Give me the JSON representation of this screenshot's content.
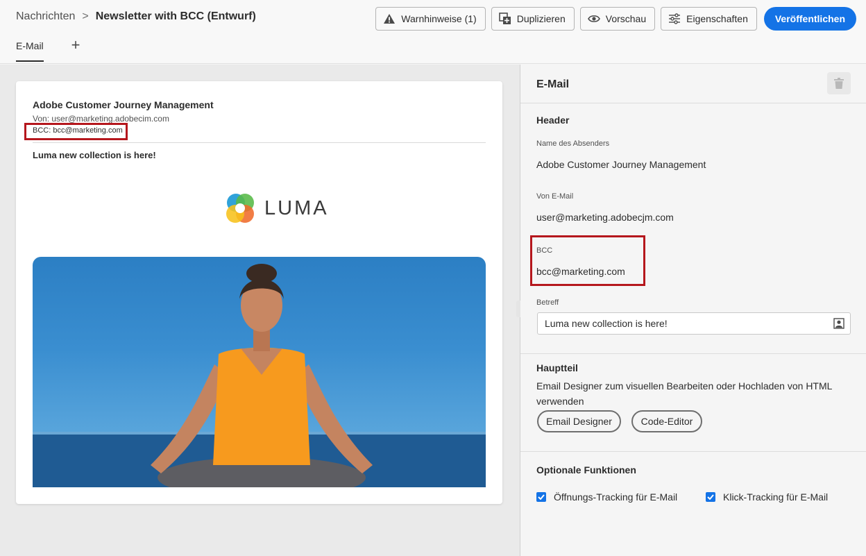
{
  "breadcrumb": {
    "parent": "Nachrichten",
    "separator": ">",
    "title": "Newsletter with BCC (Entwurf)"
  },
  "toolbar": {
    "warnings_label": "Warnhinweise (1)",
    "duplicate_label": "Duplizieren",
    "preview_label": "Vorschau",
    "properties_label": "Eigenschaften",
    "publish_label": "Veröffentlichen"
  },
  "tabs": [
    {
      "label": "E-Mail"
    }
  ],
  "tab_add_label": "+",
  "preview": {
    "sender_name": "Adobe Customer Journey Management",
    "from_line": "Von: user@marketing.adobecim.com",
    "bcc_line": "BCC: bcc@marketing.com",
    "subject": "Luma new collection is here!",
    "logo_text": "LUMA"
  },
  "panel": {
    "title": "E-Mail",
    "header_section": "Header",
    "sender_name_label": "Name des Absenders",
    "sender_name_value": "Adobe Customer Journey Management",
    "from_email_label": "Von E-Mail",
    "from_email_value": "user@marketing.adobecjm.com",
    "bcc_label": "BCC",
    "bcc_value": "bcc@marketing.com",
    "subject_label": "Betreff",
    "subject_value": "Luma new collection is here!",
    "body_section": "Hauptteil",
    "body_description": "Email Designer zum visuellen Bearbeiten oder Hochladen von HTML verwenden",
    "email_designer_label": "Email Designer",
    "code_editor_label": "Code-Editor",
    "optional_section": "Optionale Funktionen",
    "open_tracking_label": "Öffnungs-Tracking für E-Mail",
    "open_tracking_checked": true,
    "click_tracking_label": "Klick-Tracking für E-Mail",
    "click_tracking_checked": true
  },
  "colors": {
    "accent": "#1473e6",
    "highlight_box": "#b5171d"
  },
  "icons": [
    "alert-icon",
    "duplicate-icon",
    "eye-icon",
    "properties-icon",
    "add-icon",
    "trash-icon",
    "personalization-icon",
    "checkmark-icon"
  ]
}
